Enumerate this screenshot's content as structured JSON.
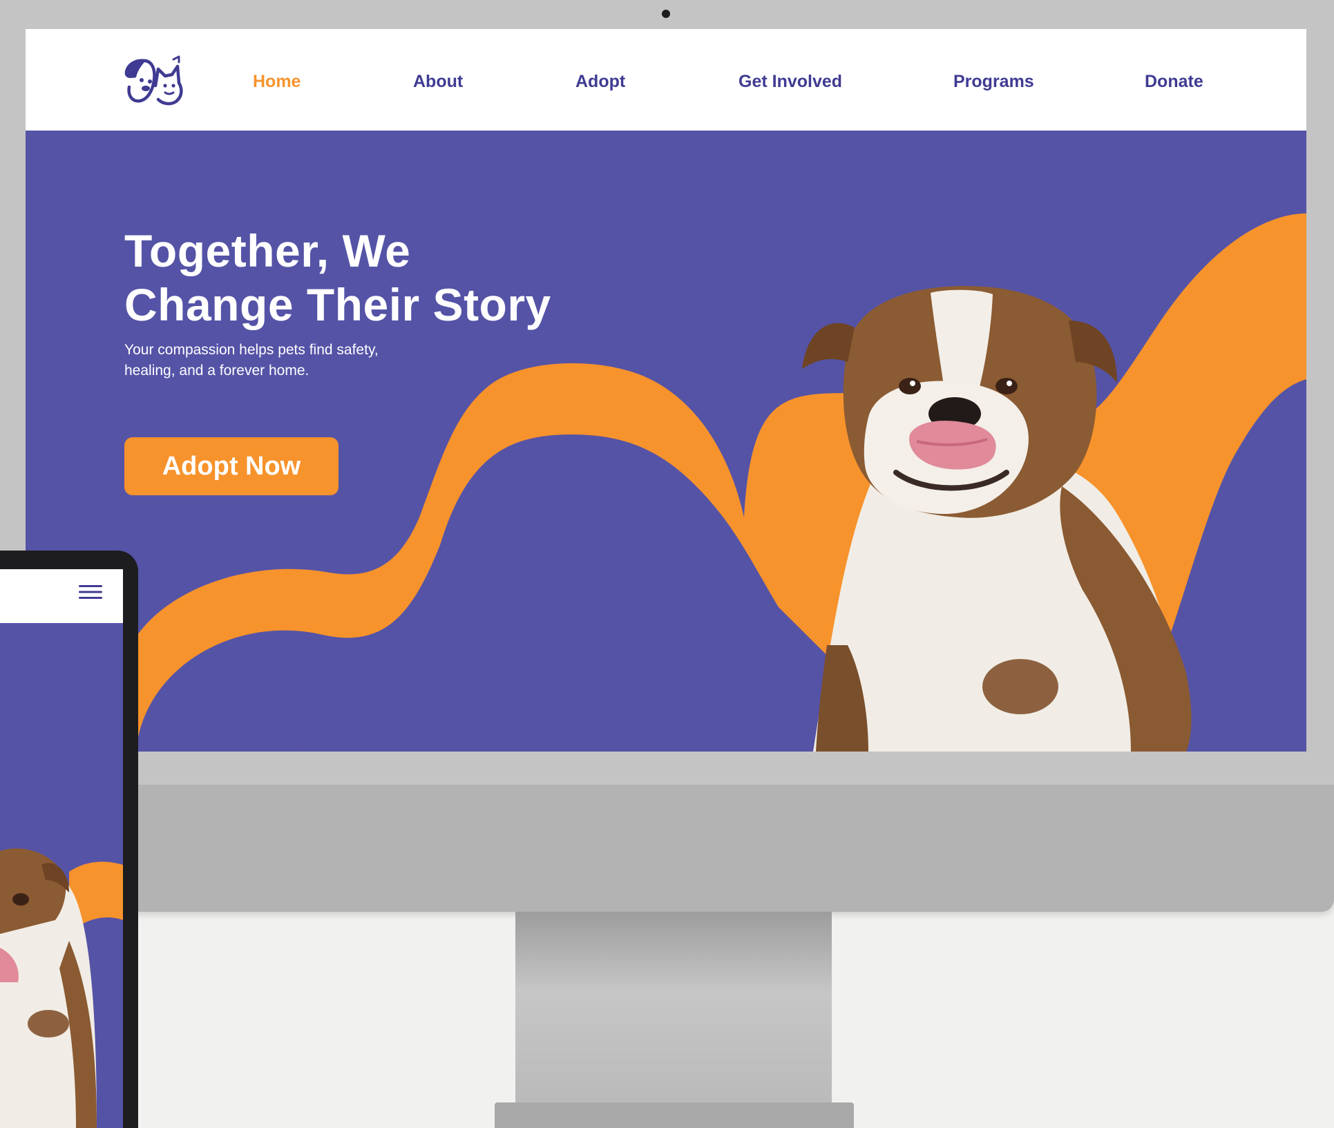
{
  "site": {
    "logo_icon": "dog-and-cat-logo-icon",
    "nav": {
      "items": [
        {
          "label": "Home",
          "active": true
        },
        {
          "label": "About",
          "active": false
        },
        {
          "label": "Adopt",
          "active": false
        },
        {
          "label": "Get Involved",
          "active": false
        },
        {
          "label": "Programs",
          "active": false
        },
        {
          "label": "Donate",
          "active": false
        }
      ]
    },
    "hero": {
      "title_lines": [
        "Together, We",
        "Change Their Story"
      ],
      "subtitle_lines": [
        "Your compassion helps pets find safety,",
        "healing, and a forever home."
      ],
      "cta_label": "Adopt Now",
      "image": "bulldog-photo"
    }
  },
  "mobile": {
    "menu_icon": "hamburger-menu-icon"
  },
  "colors": {
    "brand_purple": "#5553a6",
    "nav_text": "#3f3b92",
    "accent_orange": "#f7932c",
    "white": "#ffffff"
  }
}
